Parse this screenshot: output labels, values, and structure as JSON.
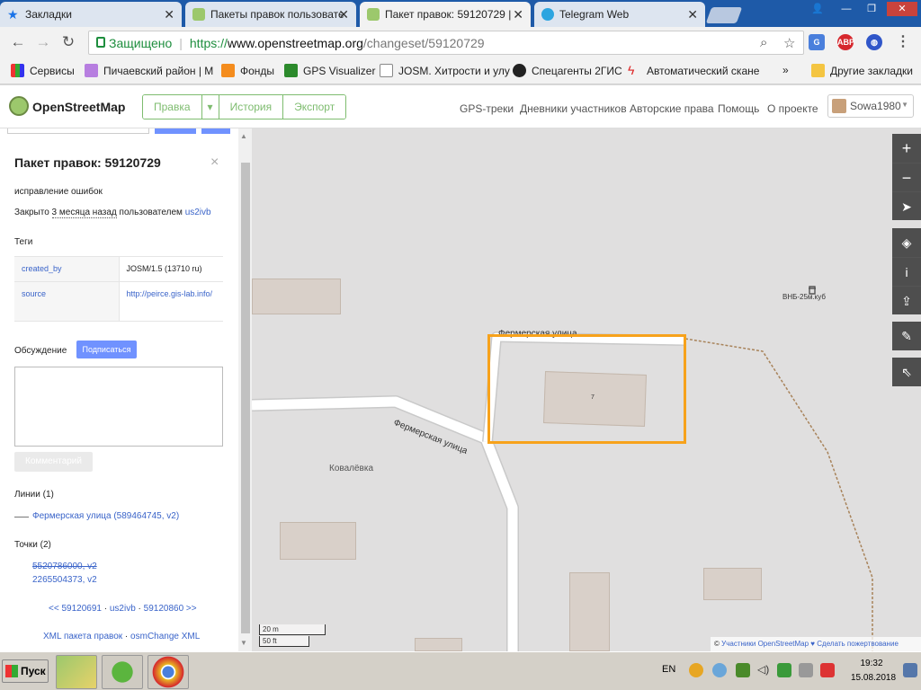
{
  "browser": {
    "tabs": [
      {
        "title": "Закладки",
        "color": "#1a73e8"
      },
      {
        "title": "Пакеты правок пользовате",
        "color": "#9cc86c"
      },
      {
        "title": "Пакет правок: 59120729 |",
        "color": "#9cc86c"
      },
      {
        "title": "Telegram Web",
        "color": "#2ca5e0"
      }
    ],
    "security_label": "Защищено",
    "url_proto": "https://",
    "url_host": "www.openstreetmap.org",
    "url_path": "/changeset/59120729"
  },
  "bookmarks": [
    {
      "label": "Сервисы",
      "icon": "apps-icon"
    },
    {
      "label": "Пичаевский район | М",
      "icon": "m-icon"
    },
    {
      "label": "Фонды",
      "icon": "fund-icon"
    },
    {
      "label": "GPS Visualizer",
      "icon": "g-icon"
    },
    {
      "label": "JOSM. Хитрости и улу",
      "icon": "page-icon"
    },
    {
      "label": "Спецагенты 2ГИС",
      "icon": "glasses-icon"
    },
    {
      "label": "Автоматический скане",
      "icon": "bolt-icon"
    }
  ],
  "bookmarks_more": "»",
  "bookmarks_other": "Другие закладки",
  "osm": {
    "title": "OpenStreetMap",
    "edit": "Правка",
    "history": "История",
    "export": "Экспорт",
    "nav": [
      "GPS-треки",
      "Дневники участников",
      "Авторские права",
      "Помощь",
      "О проекте"
    ],
    "user": "Sowa1980"
  },
  "changeset": {
    "heading": "Пакет правок: 59120729",
    "comment": "исправление ошибок",
    "closed_prefix": "Закрыто",
    "closed_when": "3 месяца назад",
    "closed_by": "пользователем",
    "user": "us2ivb",
    "tags_heading": "Теги",
    "tags": [
      {
        "key": "created_by",
        "value": "JOSM/1.5 (13710 ru)"
      },
      {
        "key": "source",
        "value": "http://peirce.gis-lab.info/"
      }
    ],
    "discussion": "Обсуждение",
    "subscribe": "Подписаться",
    "comment_btn": "Комментарий",
    "ways_heading": "Линии (1)",
    "way": "Фермерская улица (589464745, v2)",
    "nodes_heading": "Точки (2)",
    "node_deleted": "5520786000, v2",
    "node": "2265504373, v2",
    "nav_prev": "<< 59120691",
    "nav_sep1": " · ",
    "nav_user": "us2ivb",
    "nav_sep2": " · ",
    "nav_next": "59120860 >>",
    "xml": "XML пакета правок",
    "xml_sep": " · ",
    "osmchange": "osmChange XML"
  },
  "map": {
    "street1": "Фермерская улица",
    "street2": "Фермерская улица",
    "village": "Ковалёвка",
    "tower": "ВНБ-25м.куб",
    "house_no": "7",
    "scale_m": "20 m",
    "scale_ft": "50 ft",
    "attribution_prefix": "©",
    "attribution_link": "Участники OpenStreetMap",
    "attribution_heart": "♥",
    "attribution_donate": "Сделать пожертвование",
    "highlight_color": "#f7a21b"
  },
  "taskbar": {
    "start": "Пуск",
    "lang": "EN",
    "time": "19:32",
    "date": "15.08.2018"
  }
}
